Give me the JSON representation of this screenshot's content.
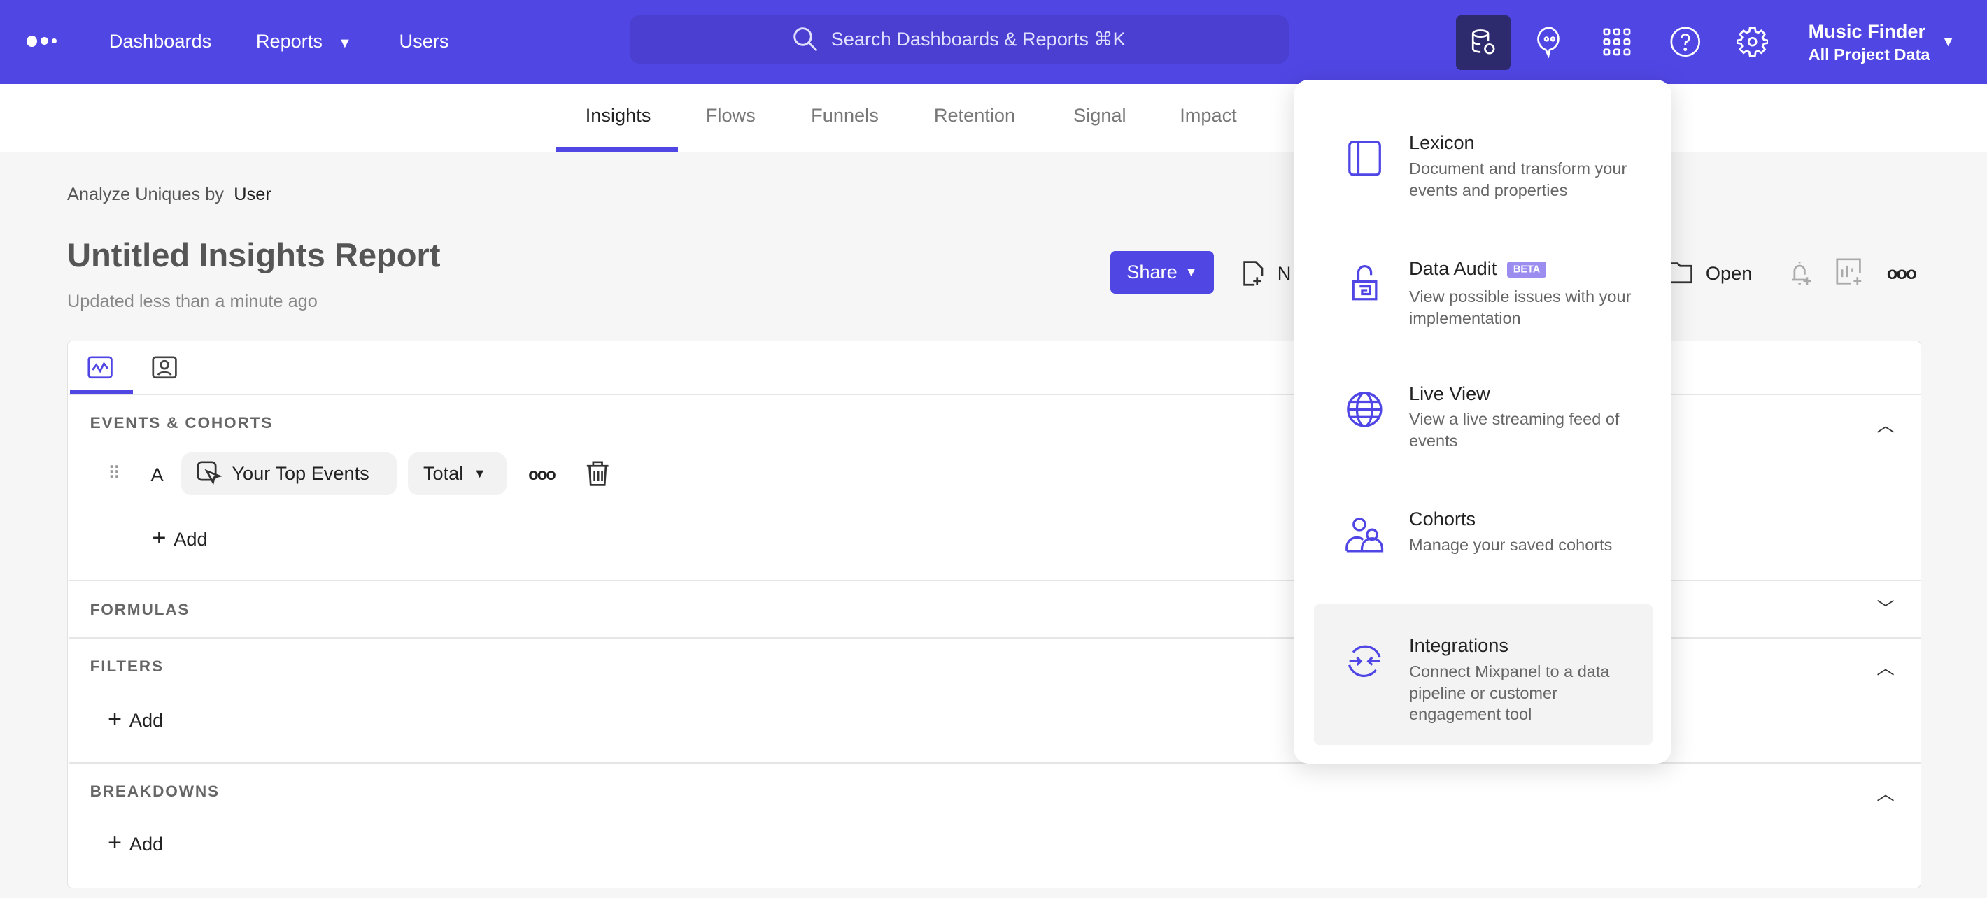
{
  "topnav": {
    "items": [
      "Dashboards",
      "Reports",
      "Users"
    ],
    "search_placeholder": "Search Dashboards & Reports ⌘K",
    "project_name": "Music Finder",
    "project_scope": "All Project Data"
  },
  "tabs": [
    "Insights",
    "Flows",
    "Funnels",
    "Retention",
    "Signal",
    "Impact"
  ],
  "report": {
    "analyze_label": "Analyze Uniques by",
    "analyze_value": "User",
    "title": "Untitled Insights Report",
    "updated": "Updated less than a minute ago",
    "share": "Share",
    "new_partial": "N",
    "open": "Open"
  },
  "query": {
    "events_header": "EVENTS & COHORTS",
    "event_letter": "A",
    "event_name": "Your Top Events",
    "measure": "Total",
    "add": "Add",
    "formulas_header": "FORMULAS",
    "filters_header": "FILTERS",
    "breakdowns_header": "BREAKDOWNS"
  },
  "menu": {
    "items": [
      {
        "title": "Lexicon",
        "desc": "Document and transform your events and properties"
      },
      {
        "title": "Data Audit",
        "badge": "BETA",
        "desc": "View possible issues with your implementation"
      },
      {
        "title": "Live View",
        "desc": "View a live streaming feed of events"
      },
      {
        "title": "Cohorts",
        "desc": "Manage your saved cohorts"
      },
      {
        "title": "Integrations",
        "desc": "Connect Mixpanel to a data pipeline or customer engagement tool"
      }
    ]
  },
  "colors": {
    "brand": "#5046e4",
    "accent_icon": "#4f46e5"
  }
}
